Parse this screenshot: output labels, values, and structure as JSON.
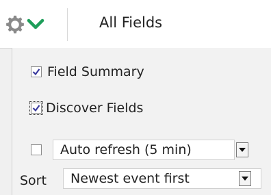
{
  "toolbar": {
    "gear_icon": "gear-icon",
    "chevron_icon": "chevron-down-icon",
    "accent_color": "#1e9e5a",
    "field_filter": {
      "selected": "All Fields"
    }
  },
  "options": {
    "field_summary": {
      "label": "Field Summary",
      "checked": true
    },
    "discover_fields": {
      "label": "Discover Fields",
      "checked": true
    },
    "auto_refresh": {
      "checked": false,
      "interval": "Auto refresh (5 min)"
    }
  },
  "sort": {
    "label": "Sort",
    "selected": "Newest event first"
  }
}
